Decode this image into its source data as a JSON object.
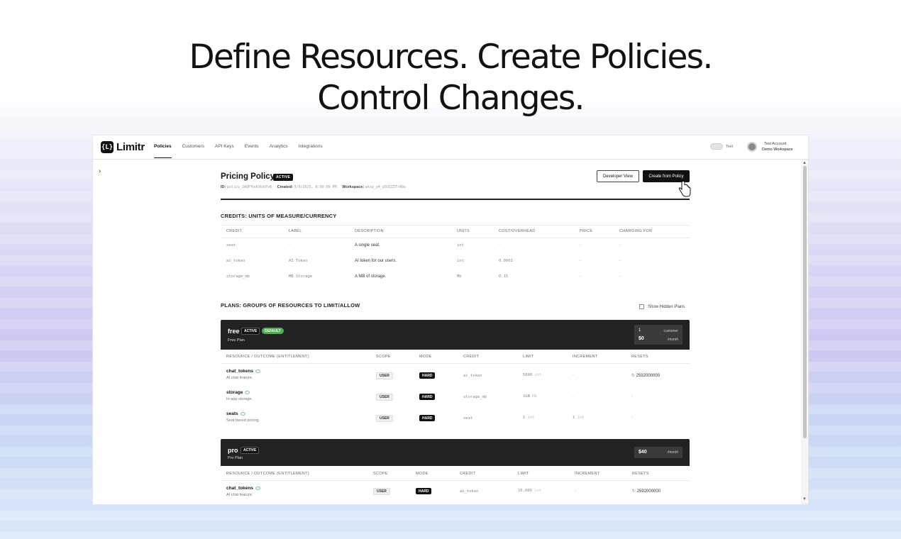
{
  "headline": {
    "line1": "Define Resources. Create Policies.",
    "line2": "Control Changes."
  },
  "nav": {
    "logo_mark": "{L}",
    "logo_text": "Limitr",
    "tabs": [
      "Policies",
      "Customers",
      "API Keys",
      "Events",
      "Analytics",
      "Integrations"
    ],
    "active_tab": "Policies",
    "toggle_label": "Test",
    "account_name": "Test Account",
    "workspace_name": "Demo Workspace"
  },
  "policy": {
    "title": "Pricing Policy",
    "status": "ACTIVE",
    "id_label": "ID:",
    "id_value": "policy_2AQFYbdCHzU7v8",
    "created_label": "Created:",
    "created_value": "3/9/2025, 6:09:09 PM",
    "workspace_label": "Workspace:",
    "workspace_value": "wksp_y4_p5UIZ5TrA0a",
    "developer_view_label": "Developer View",
    "create_from_policy_label": "Create from Policy"
  },
  "credits": {
    "title": "CREDITS: UNITS OF MEASURE/CURRENCY",
    "columns": [
      "CREDIT",
      "LABEL",
      "DESCRIPTION",
      "UNITS",
      "COST/OVERHEAD",
      "PRICE",
      "CHARGING FOR"
    ],
    "rows": [
      {
        "credit": "seat",
        "label": "-",
        "description": "A single seat.",
        "units": "int",
        "cost": "-",
        "price": "-",
        "charging_for": "-"
      },
      {
        "credit": "ai_token",
        "label": "AI Token",
        "description": "AI token for our users.",
        "units": "int",
        "cost": "0.0001",
        "price": "-",
        "charging_for": "-"
      },
      {
        "credit": "storage_mb",
        "label": "MB Storage",
        "description": "A MB of storage.",
        "units": "Mb",
        "cost": "0.15",
        "price": "-",
        "charging_for": "-"
      }
    ]
  },
  "plans": {
    "title": "PLANS: GROUPS OF RESOURCES TO LIMIT/ALLOW",
    "show_hidden_label": "Show Hidden Plans",
    "list": [
      {
        "name": "free",
        "status": "ACTIVE",
        "default_badge": "DEFAULT",
        "subtitle": "Free Plan",
        "qty": "1",
        "qty_label": "customer",
        "price": "$0",
        "per": "/month",
        "columns": [
          "RESOURCE / OUTCOME (ENTITLEMENT)",
          "SCOPE",
          "MODE",
          "CREDIT",
          "LIMIT",
          "INCREMENT",
          "RESETS"
        ],
        "rows": [
          {
            "name": "chat_tokens",
            "desc": "AI chat feature.",
            "scope": "USER",
            "mode": "HARD",
            "credit": "ai_token",
            "limit": "5000",
            "limit_unit": "int",
            "increment": "-",
            "resets": "2592000000"
          },
          {
            "name": "storage",
            "desc": "In-app storage.",
            "scope": "USER",
            "mode": "HARD",
            "credit": "storage_mb",
            "limit": "1GB",
            "limit_unit": "Mb",
            "increment": "-",
            "resets": "-"
          },
          {
            "name": "seats",
            "desc": "Seat based pricing.",
            "scope": "USER",
            "mode": "HARD",
            "credit": "seat",
            "limit": "1",
            "limit_unit": "int",
            "increment": "1",
            "increment_unit": "int",
            "resets": "-"
          }
        ]
      },
      {
        "name": "pro",
        "status": "ACTIVE",
        "subtitle": "Pro Plan",
        "price": "$40",
        "per": "/month",
        "columns": [
          "RESOURCE / OUTCOME (ENTITLEMENT)",
          "SCOPE",
          "MODE",
          "CREDIT",
          "LIMIT",
          "INCREMENT",
          "RESETS"
        ],
        "rows": [
          {
            "name": "chat_tokens",
            "desc": "AI chat feature.",
            "scope": "USER",
            "mode": "HARD",
            "credit": "ai_token",
            "limit": "10,000",
            "limit_unit": "int",
            "increment": "-",
            "resets": "2592000000"
          }
        ]
      }
    ]
  }
}
